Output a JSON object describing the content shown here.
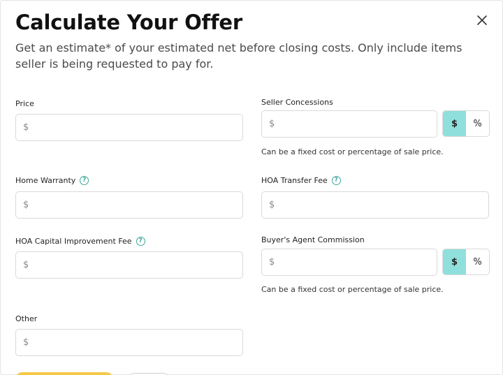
{
  "modal": {
    "title": "Calculate Your Offer",
    "subtitle": "Get an estimate* of your estimated net before closing costs. Only include items seller is being requested to pay for.",
    "close_icon": "close-icon"
  },
  "fields": {
    "price": {
      "label": "Price",
      "currency_symbol": "$",
      "value": ""
    },
    "seller_concessions": {
      "label": "Seller Concessions",
      "currency_symbol": "$",
      "value": "",
      "hint": "Can be a fixed cost or percentage of sale price.",
      "toggle_dollar": "$",
      "toggle_percent": "%",
      "selected": "$"
    },
    "home_warranty": {
      "label": "Home Warranty",
      "currency_symbol": "$",
      "value": "",
      "help_icon": "?"
    },
    "hoa_transfer_fee": {
      "label": "HOA Transfer Fee",
      "currency_symbol": "$",
      "value": "",
      "help_icon": "?"
    },
    "hoa_capital_improvement_fee": {
      "label": "HOA Capital Improvement Fee",
      "currency_symbol": "$",
      "value": "",
      "help_icon": "?"
    },
    "buyers_agent_commission": {
      "label": "Buyer's Agent Commission",
      "currency_symbol": "$",
      "value": "",
      "hint": "Can be a fixed cost or percentage of sale price.",
      "toggle_dollar": "$",
      "toggle_percent": "%",
      "selected": "$"
    },
    "other": {
      "label": "Other",
      "currency_symbol": "$",
      "value": ""
    }
  },
  "colors": {
    "accent_teal": "#8fe0dc",
    "help_teal": "#3fa79b",
    "primary_button": "#f6c84a"
  }
}
